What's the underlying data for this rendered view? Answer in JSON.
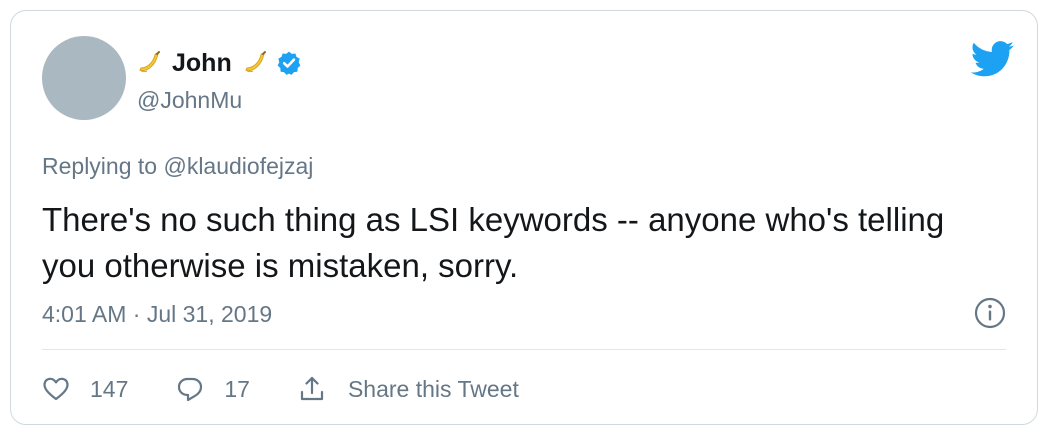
{
  "author": {
    "display_name": "John",
    "handle": "@JohnMu",
    "name_emoji": "banana-emoji",
    "verified_icon": "verified-badge-icon"
  },
  "reply": {
    "prefix": "Replying to ",
    "to": "@klaudiofejzaj"
  },
  "tweet": {
    "text": "There's no such thing as LSI keywords -- anyone who's telling you otherwise is mistaken, sorry."
  },
  "meta": {
    "time": "4:01 AM",
    "separator": " · ",
    "date": "Jul 31, 2019"
  },
  "actions": {
    "likes": "147",
    "replies": "17",
    "share_label": "Share this Tweet"
  },
  "colors": {
    "twitter_blue": "#1da1f2",
    "secondary_text": "#657786",
    "primary_text": "#14171a",
    "avatar_placeholder": "#aab8c2",
    "border": "#cfd9de"
  },
  "icons": {
    "brand": "twitter-bird-icon",
    "info": "info-icon",
    "like": "heart-icon",
    "reply": "reply-bubble-icon",
    "share": "share-icon"
  }
}
